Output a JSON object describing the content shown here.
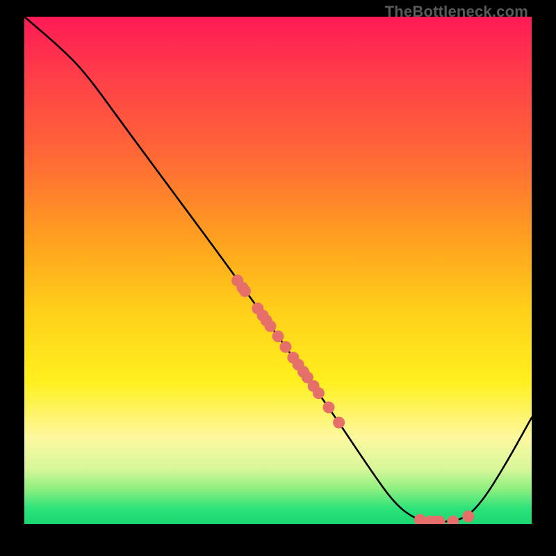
{
  "attribution": "TheBottleneck.com",
  "chart_data": {
    "type": "line",
    "title": "",
    "xlabel": "",
    "ylabel": "",
    "xlim": [
      0,
      100
    ],
    "ylim": [
      0,
      100
    ],
    "curve": {
      "name": "bottleneck-curve",
      "color": "#000000",
      "points": [
        {
          "x": 0,
          "y": 100
        },
        {
          "x": 7,
          "y": 94
        },
        {
          "x": 12,
          "y": 89
        },
        {
          "x": 20,
          "y": 78
        },
        {
          "x": 30,
          "y": 64.5
        },
        {
          "x": 40,
          "y": 51
        },
        {
          "x": 50,
          "y": 37
        },
        {
          "x": 60,
          "y": 23
        },
        {
          "x": 68,
          "y": 11
        },
        {
          "x": 73,
          "y": 4
        },
        {
          "x": 77,
          "y": 1
        },
        {
          "x": 80,
          "y": 0.5
        },
        {
          "x": 86,
          "y": 0.5
        },
        {
          "x": 90,
          "y": 4
        },
        {
          "x": 95,
          "y": 12
        },
        {
          "x": 100,
          "y": 21
        }
      ]
    },
    "scatter": {
      "name": "data-points",
      "color": "#e76f6a",
      "points": [
        {
          "x": 42,
          "y": 48
        },
        {
          "x": 43,
          "y": 46.6
        },
        {
          "x": 43.5,
          "y": 45.9
        },
        {
          "x": 46,
          "y": 42.5
        },
        {
          "x": 47,
          "y": 41.1
        },
        {
          "x": 47.7,
          "y": 40.1
        },
        {
          "x": 48.5,
          "y": 39
        },
        {
          "x": 50,
          "y": 37
        },
        {
          "x": 51.5,
          "y": 34.9
        },
        {
          "x": 53,
          "y": 32.8
        },
        {
          "x": 54,
          "y": 31.4
        },
        {
          "x": 55,
          "y": 30
        },
        {
          "x": 55.8,
          "y": 28.9
        },
        {
          "x": 57,
          "y": 27.2
        },
        {
          "x": 58,
          "y": 25.8
        },
        {
          "x": 60,
          "y": 23
        },
        {
          "x": 62,
          "y": 20
        },
        {
          "x": 78,
          "y": 0.8
        },
        {
          "x": 80,
          "y": 0.5
        },
        {
          "x": 81,
          "y": 0.5
        },
        {
          "x": 81.8,
          "y": 0.5
        },
        {
          "x": 84.5,
          "y": 0.5
        },
        {
          "x": 87.5,
          "y": 1.5
        }
      ]
    }
  }
}
